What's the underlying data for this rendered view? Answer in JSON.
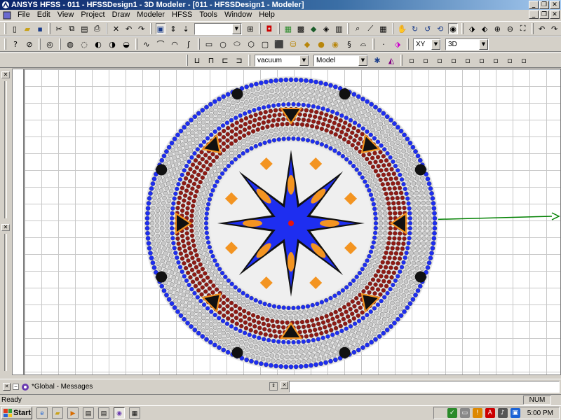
{
  "window": {
    "title": "ANSYS HFSS - 011 - HFSSDesign1 - 3D Modeler - [011 - HFSSDesign1 - Modeler]"
  },
  "menu": [
    "File",
    "Edit",
    "View",
    "Project",
    "Draw",
    "Modeler",
    "HFSS",
    "Tools",
    "Window",
    "Help"
  ],
  "toolbars": {
    "material": "vacuum",
    "model_type": "Model",
    "plane": "XY",
    "view_mode": "3D",
    "empty_combo": ""
  },
  "messages": {
    "title": "*Global - Messages"
  },
  "status": {
    "text": "Ready",
    "num": "NUM"
  },
  "taskbar": {
    "start": "Start",
    "clock": "5:00 PM"
  },
  "model": {
    "colors": {
      "blue": "#1e2ef0",
      "gray": "#c9c9c9",
      "maroon": "#8e1a14",
      "orange": "#f39421",
      "black": "#111111",
      "red": "#e8140a",
      "axis": "#008000"
    }
  }
}
